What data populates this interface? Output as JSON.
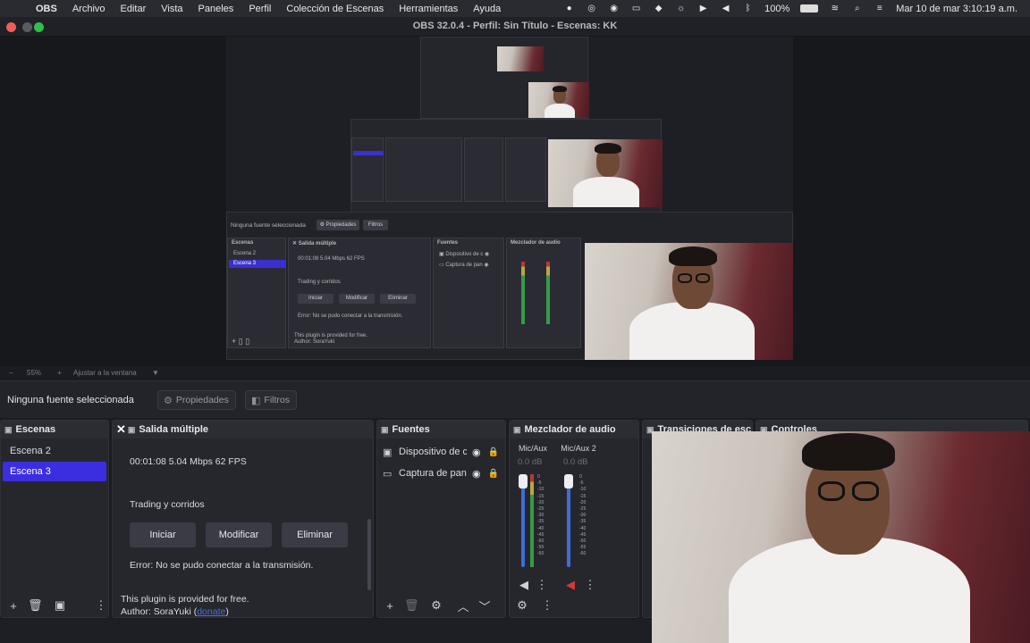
{
  "menubar": {
    "app": "OBS",
    "items": [
      "Archivo",
      "Editar",
      "Vista",
      "Paneles",
      "Perfil",
      "Colección de Escenas",
      "Herramientas",
      "Ayuda"
    ],
    "battery": "100%",
    "clock": "Mar 10 de mar  3:10:19 a.m."
  },
  "window": {
    "title": "OBS 32.0.4 - Perfil: Sin Título - Escenas: KK"
  },
  "preview": {
    "zoom": "55%",
    "fit_label": "Ajustar a la ventana",
    "nested_scenes": [
      "Escena 2",
      "Escena 3"
    ],
    "nested_stats": "00:01:08  5.04 Mbps  62 FPS",
    "nested_heading": "Trading y corridos",
    "nested_buttons": [
      "Iniciar",
      "Modificar",
      "Eliminar"
    ],
    "nested_error": "Error: No se pudo conectar a la transmisión.",
    "nested_plugin": "This plugin is provided for free.",
    "nested_author": "Author: SoraYuki"
  },
  "toolbar": {
    "no_source": "Ninguna fuente seleccionada",
    "properties": "Propiedades",
    "filters": "Filtros"
  },
  "scenes": {
    "title": "Escenas",
    "items": [
      "Escena 2",
      "Escena 3"
    ],
    "selected": "Escena 3"
  },
  "multi": {
    "title": "Salida múltiple",
    "stats": "00:01:08  5.04 Mbps  62 FPS",
    "heading": "Trading y corridos",
    "start": "Iniciar",
    "modify": "Modificar",
    "delete": "Eliminar",
    "error": "Error: No se pudo conectar a la transmisión.",
    "plugin": "This plugin is provided for free.",
    "author": "Author: SoraYuki (",
    "donate": "donate",
    "author_end": ")"
  },
  "sources": {
    "title": "Fuentes",
    "items": [
      {
        "icon": "camera-icon",
        "label": "Dispositivo de c"
      },
      {
        "icon": "monitor-icon",
        "label": "Captura de pan"
      }
    ]
  },
  "mixer": {
    "title": "Mezclador de audio",
    "channels": [
      {
        "name": "Mic/Aux",
        "db": "0.0 dB"
      },
      {
        "name": "Mic/Aux 2",
        "db": "0.0 dB"
      }
    ],
    "ticks": [
      "0",
      "-5",
      "-10",
      "-15",
      "-20",
      "-25",
      "-30",
      "-35",
      "-40",
      "-45",
      "-50",
      "-55",
      "-60"
    ]
  },
  "transitions": {
    "title": "Transiciones de esc"
  },
  "controls": {
    "title": "Controles"
  }
}
